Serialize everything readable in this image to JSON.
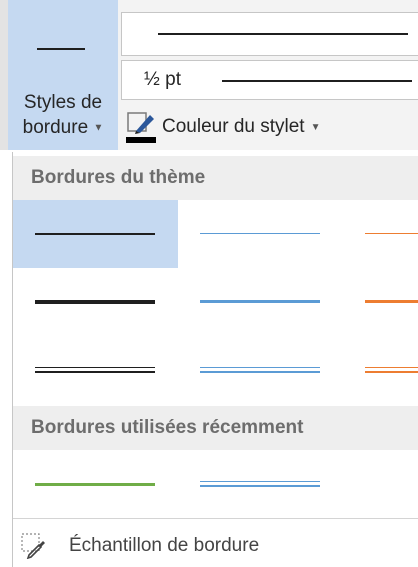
{
  "ribbon": {
    "border_styles_button": {
      "line1": "Styles de",
      "line2": "bordure"
    },
    "pen_weight": "½ pt",
    "pen_color_label": "Couleur du stylet"
  },
  "panel": {
    "theme_header": "Bordures du thème",
    "recent_header": "Bordures utilisées récemment",
    "footer_label": "Échantillon de bordure"
  },
  "colors": {
    "black": "#1f1f1f",
    "blue": "#5b9bd5",
    "orange": "#ed7d31",
    "green": "#70ad47",
    "selected": "#c5d9f1"
  }
}
